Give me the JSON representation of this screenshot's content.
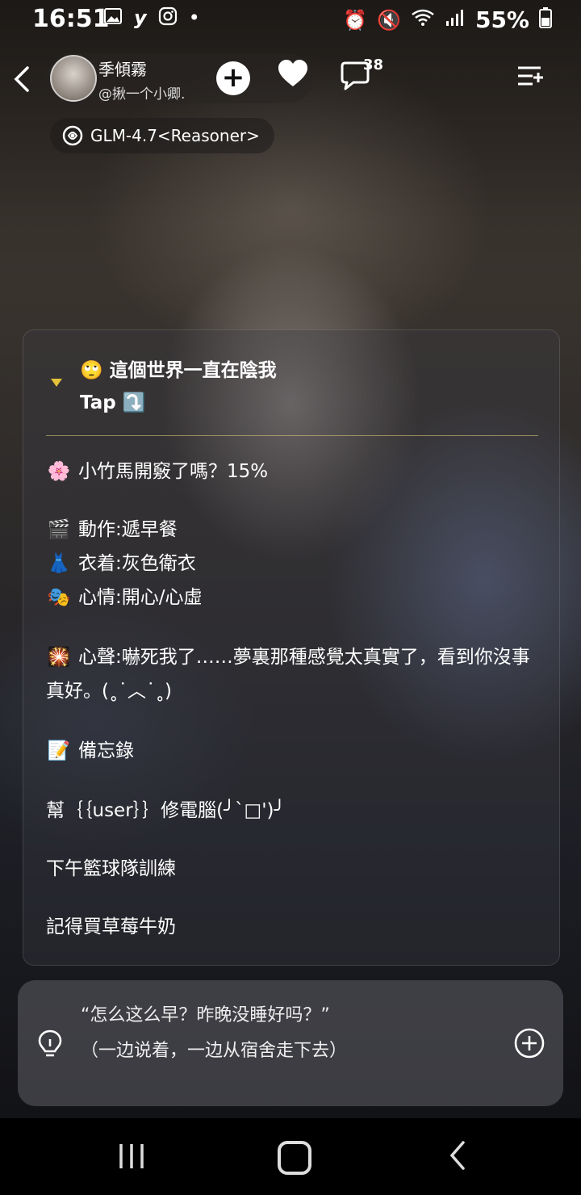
{
  "status_bar": {
    "time": "16:51",
    "left_icons": [
      "gallery-icon",
      "y-app-icon",
      "instagram-icon",
      "dot-icon"
    ],
    "battery": "55%",
    "right_icons": [
      "alarm-icon",
      "mute-icon",
      "wifi-icon",
      "signal-icon",
      "battery-icon"
    ]
  },
  "header": {
    "character_name": "季傾霧",
    "character_handle": "@揪一个小卿.",
    "comment_count": "38"
  },
  "model": {
    "label": "GLM-4.7<Reasoner>"
  },
  "card": {
    "title_line1": "🙄 這個世界一直在陰我",
    "title_line2": "Tap ⤵️",
    "affection": {
      "emoji": "🌸",
      "text": "小竹馬開竅了嗎？15%"
    },
    "action": {
      "emoji": "🎬",
      "text": "動作:遞早餐"
    },
    "outfit": {
      "emoji": "👗",
      "text": "衣着:灰色衛衣"
    },
    "mood": {
      "emoji": "🎭",
      "text": "心情:開心/心虛"
    },
    "inner_voice": {
      "emoji": "🎇",
      "text": "心聲:嚇死我了……夢裏那種感覺太真實了，看到你沒事真好。(˳˙︿˙˳)"
    },
    "memo": {
      "emoji": "📝",
      "text": "備忘錄"
    },
    "memo_items": [
      "幫｛｛user｝｝修電腦(╯`□')╯",
      "下午籃球隊訓練",
      "記得買草莓牛奶"
    ]
  },
  "input": {
    "line1": "“怎么这么早？昨晚没睡好吗？”",
    "line2": "（一边说着，一边从宿舍走下去）"
  }
}
